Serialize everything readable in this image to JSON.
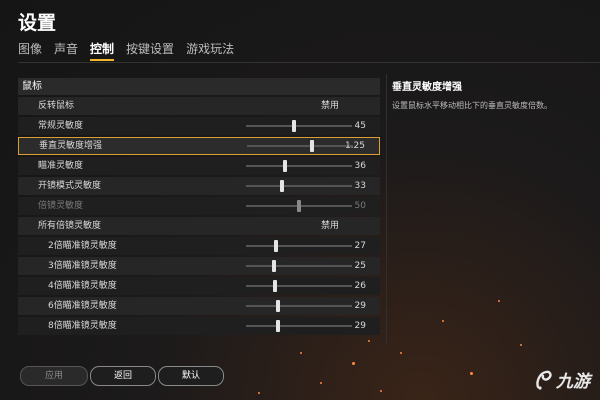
{
  "title": "设置",
  "tabs": [
    {
      "label": "图像",
      "active": false
    },
    {
      "label": "声音",
      "active": false
    },
    {
      "label": "控制",
      "active": true
    },
    {
      "label": "按键设置",
      "active": false
    },
    {
      "label": "游戏玩法",
      "active": false
    }
  ],
  "section": {
    "title": "鼠标"
  },
  "rows": [
    {
      "label": "反转鼠标",
      "type": "toggle",
      "value": "禁用"
    },
    {
      "label": "常规灵敏度",
      "type": "slider",
      "value": "45",
      "fill": 0.45
    },
    {
      "label": "垂直灵敏度增强",
      "type": "slider",
      "value": "1.25",
      "fill": 0.62,
      "selected": true
    },
    {
      "label": "瞄准灵敏度",
      "type": "slider",
      "value": "36",
      "fill": 0.36
    },
    {
      "label": "开镜模式灵敏度",
      "type": "slider",
      "value": "33",
      "fill": 0.33
    },
    {
      "label": "倍镜灵敏度",
      "type": "slider",
      "value": "50",
      "fill": 0.5,
      "dim": true
    },
    {
      "label": "所有倍镜灵敏度",
      "type": "toggle",
      "value": "禁用"
    },
    {
      "label": "2倍瞄准镜灵敏度",
      "type": "slider",
      "value": "27",
      "fill": 0.27,
      "sub": true
    },
    {
      "label": "3倍瞄准镜灵敏度",
      "type": "slider",
      "value": "25",
      "fill": 0.25,
      "sub": true
    },
    {
      "label": "4倍瞄准镜灵敏度",
      "type": "slider",
      "value": "26",
      "fill": 0.26,
      "sub": true
    },
    {
      "label": "6倍瞄准镜灵敏度",
      "type": "slider",
      "value": "29",
      "fill": 0.29,
      "sub": true
    },
    {
      "label": "8倍瞄准镜灵敏度",
      "type": "slider",
      "value": "29",
      "fill": 0.29,
      "sub": true
    }
  ],
  "info": {
    "title": "垂直灵敏度增强",
    "description": "设置鼠标水平移动相比下的垂直灵敏度倍数。"
  },
  "buttons": {
    "apply": "应用",
    "back": "返回",
    "default": "默认"
  },
  "logo": {
    "text": "九游",
    "icon": "jiuyou-logo-icon"
  },
  "colors": {
    "accent": "#d9a032",
    "background": "#1a1a1a"
  }
}
